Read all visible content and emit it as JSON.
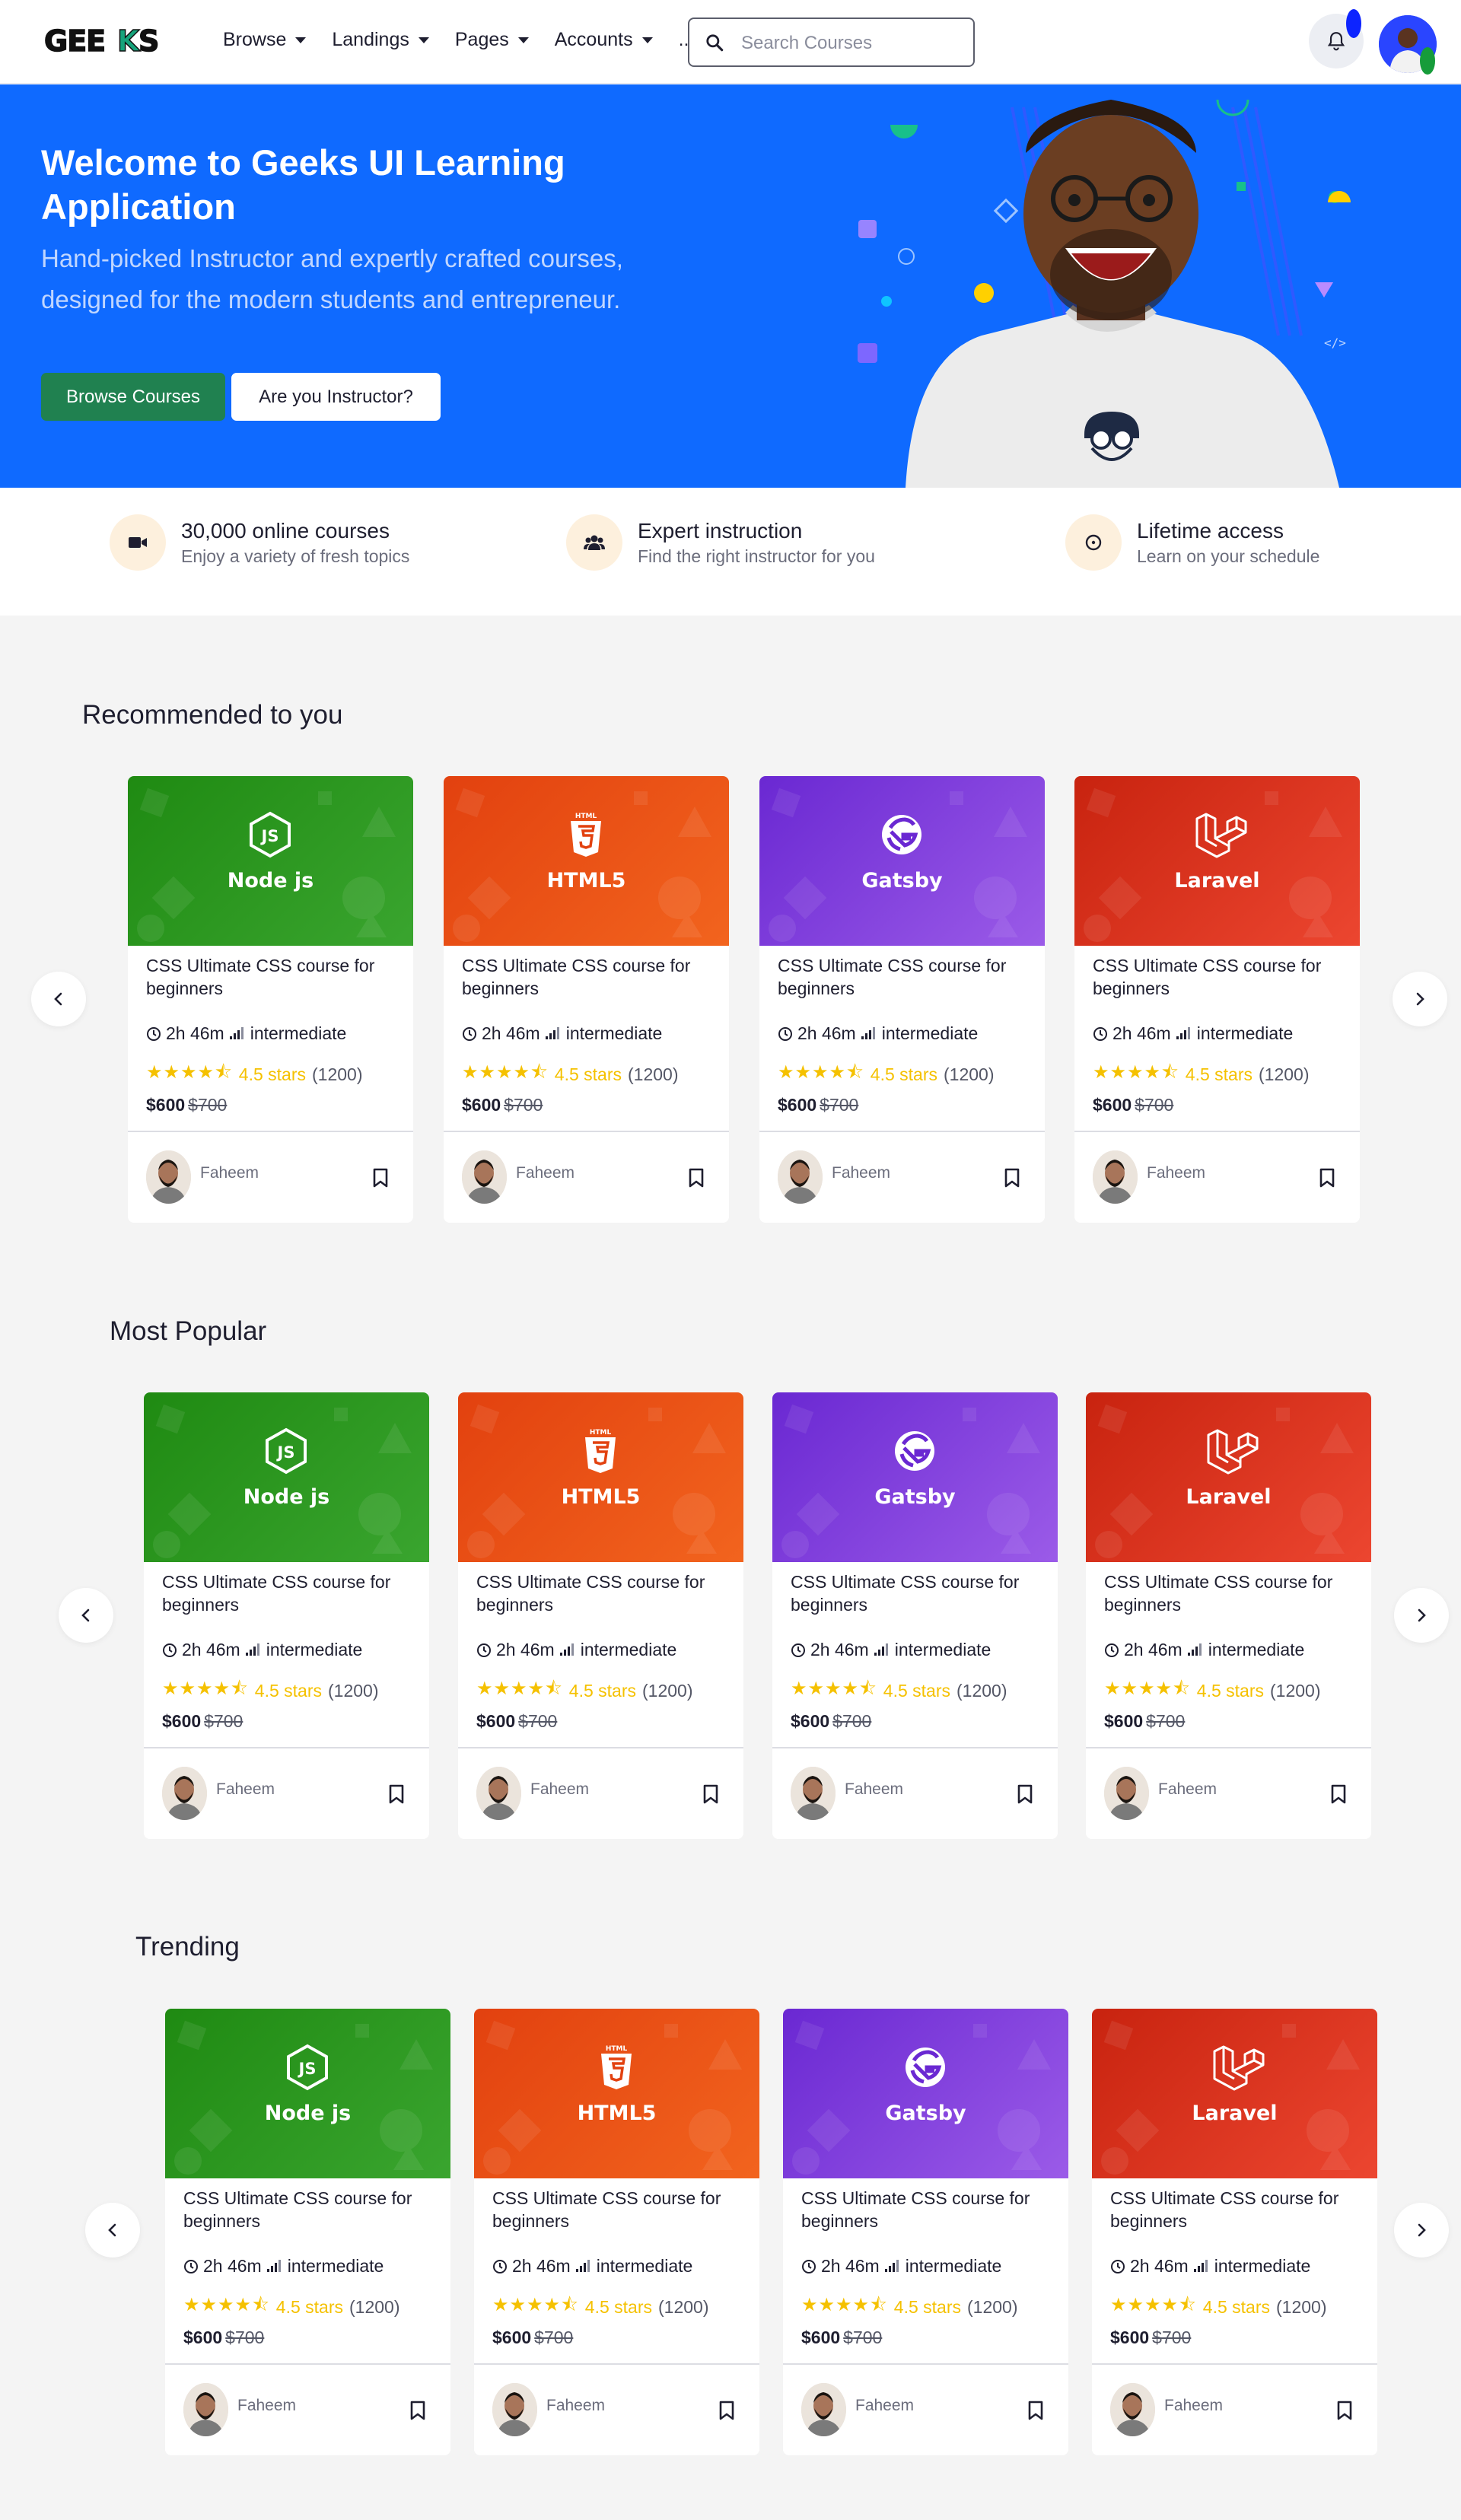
{
  "brand": {
    "logo_text": "GEEKS"
  },
  "nav": {
    "menu": [
      "Browse",
      "Landings",
      "Pages",
      "Accounts"
    ],
    "more": "...",
    "search_placeholder": "Search Courses"
  },
  "hero": {
    "title": "Welcome to Geeks UI Learning Application",
    "subtitle": "Hand-picked Instructor and expertly crafted courses, designed for the modern students and entrepreneur.",
    "primary_button": "Browse Courses",
    "secondary_button": "Are you Instructor?"
  },
  "features": [
    {
      "icon": "video-camera-icon",
      "title": "30,000 online courses",
      "subtitle": "Enjoy a variety of fresh topics"
    },
    {
      "icon": "users-icon",
      "title": "Expert instruction",
      "subtitle": "Find the right instructor for you"
    },
    {
      "icon": "clock-icon",
      "title": "Lifetime access",
      "subtitle": "Learn on your schedule"
    }
  ],
  "course": {
    "title": "CSS Ultimate CSS course for beginners",
    "duration": "2h 46m",
    "level": "intermediate",
    "rating_text": "4.5 stars",
    "rating_value": 4.5,
    "reviews": "(1200)",
    "price": "$600",
    "old_price": "$700",
    "author": "Faheem"
  },
  "topics": [
    {
      "label": "Node js",
      "icon": "nodejs-icon",
      "color_a": "#1f8a12",
      "color_b": "#3aa52f"
    },
    {
      "label": "HTML5",
      "icon": "html5-icon",
      "color_a": "#e2410f",
      "color_b": "#f2641e"
    },
    {
      "label": "Gatsby",
      "icon": "gatsby-icon",
      "color_a": "#6a28d2",
      "color_b": "#9b5be8"
    },
    {
      "label": "Laravel",
      "icon": "laravel-icon",
      "color_a": "#c8230f",
      "color_b": "#ec4630"
    }
  ],
  "sections": [
    {
      "title": "Recommended to you"
    },
    {
      "title": "Most Popular"
    },
    {
      "title": "Trending"
    }
  ],
  "colors": {
    "hero_bg": "#0f6aff",
    "accent_green": "#208150",
    "star": "#f5c100"
  }
}
